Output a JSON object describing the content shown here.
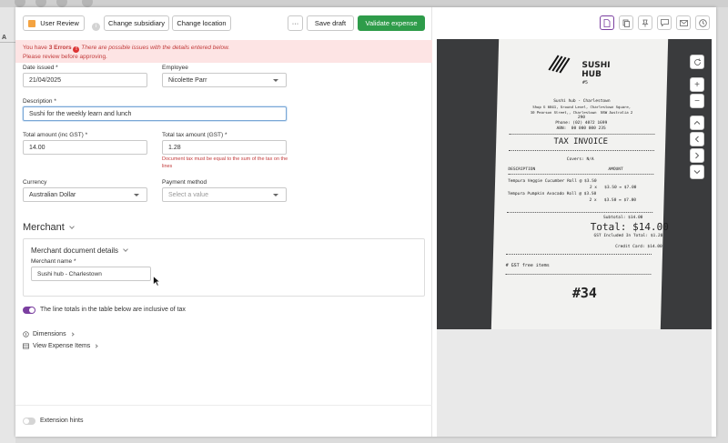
{
  "toolbar": {
    "user_review": "User Review",
    "change_subsidiary": "Change subsidiary",
    "change_location": "Change location",
    "more": "···",
    "save_draft": "Save draft",
    "validate_expense": "Validate expense"
  },
  "errors": {
    "prefix": "You have ",
    "count": "3 Errors",
    "message": "There are possible issues with the details entered below.",
    "instruction": "Please review before approving."
  },
  "form": {
    "date_issued_label": "Date issued *",
    "date_issued_value": "21/04/2025",
    "employee_label": "Employee",
    "employee_value": "Nicolette Parr",
    "description_label": "Description *",
    "description_value": "Sushi for the weekly learn and lunch",
    "total_amount_label": "Total amount (inc GST) *",
    "total_amount_value": "14.00",
    "total_tax_label": "Total tax amount (GST) *",
    "total_tax_value": "1.28",
    "tax_error": "Document tax must be equal to the sum of the tax on the lines",
    "currency_label": "Currency",
    "currency_value": "Australian Dollar",
    "payment_label": "Payment method",
    "payment_placeholder": "Select a value"
  },
  "merchant": {
    "title": "Merchant",
    "details_title": "Merchant document details",
    "name_label": "Merchant name *",
    "name_value": "Sushi hub - Charlestown"
  },
  "options": {
    "inclusive_tax": "The line totals in the table below are inclusive of tax",
    "dimensions": "Dimensions",
    "view_items": "View Expense Items",
    "extension_hints": "Extension hints"
  },
  "sidebar_bg": {
    "letter": "A"
  },
  "receipt": {
    "logo_line1": "SUSHI",
    "logo_line2": "HUB",
    "logo_line3": "#5",
    "addr1": "Sushi hub - Charlestown",
    "addr2": "Shop G 6041, Ground Level, Charlestown Square,",
    "addr3": "30 Pearson Street,, Charlestown  NSW Australia 2",
    "addr4": "290",
    "phone": "Phone: (02) 4072 1699",
    "abn": "ABN:  00 000 000 235",
    "tax_invoice": "TAX INVOICE",
    "covers": "Covers: N/A",
    "col_desc": "DESCRIPTION",
    "col_amount": "AMOUNT",
    "item1": "Tempura Veggie Cucumber Roll @ $3.50",
    "item1_qty": "2 x   $3.50 = $7.00",
    "item2": "Tempura Pumpkin Avocado Roll @ $3.50",
    "item2_qty": "2 x   $3.50 = $7.00",
    "subtotal": "Subtotal: $14.00",
    "total": "Total: $14.00",
    "gst_incl": "GST Included In Total: $1.28",
    "credit": "Credit Card: $14.00",
    "gst_free": "# GST free items",
    "order_no": "#34"
  },
  "colors": {
    "primary_green": "#2e9c4a",
    "error_red": "#c23b3b",
    "error_bg": "#fde4e4",
    "toggle_purple": "#7b3fa0",
    "accent_orange": "#f4a340"
  },
  "icons": [
    "info-icon",
    "error-icon",
    "caret-down-icon",
    "chevron-right-icon",
    "dimensions-icon",
    "list-icon",
    "document-icon",
    "copy-icon",
    "pin-icon",
    "comment-icon",
    "mail-icon",
    "history-icon",
    "refresh-icon",
    "zoom-in-icon",
    "zoom-out-icon",
    "chevron-up-icon",
    "chevron-left-icon",
    "chevron-down-icon",
    "cursor-icon"
  ]
}
